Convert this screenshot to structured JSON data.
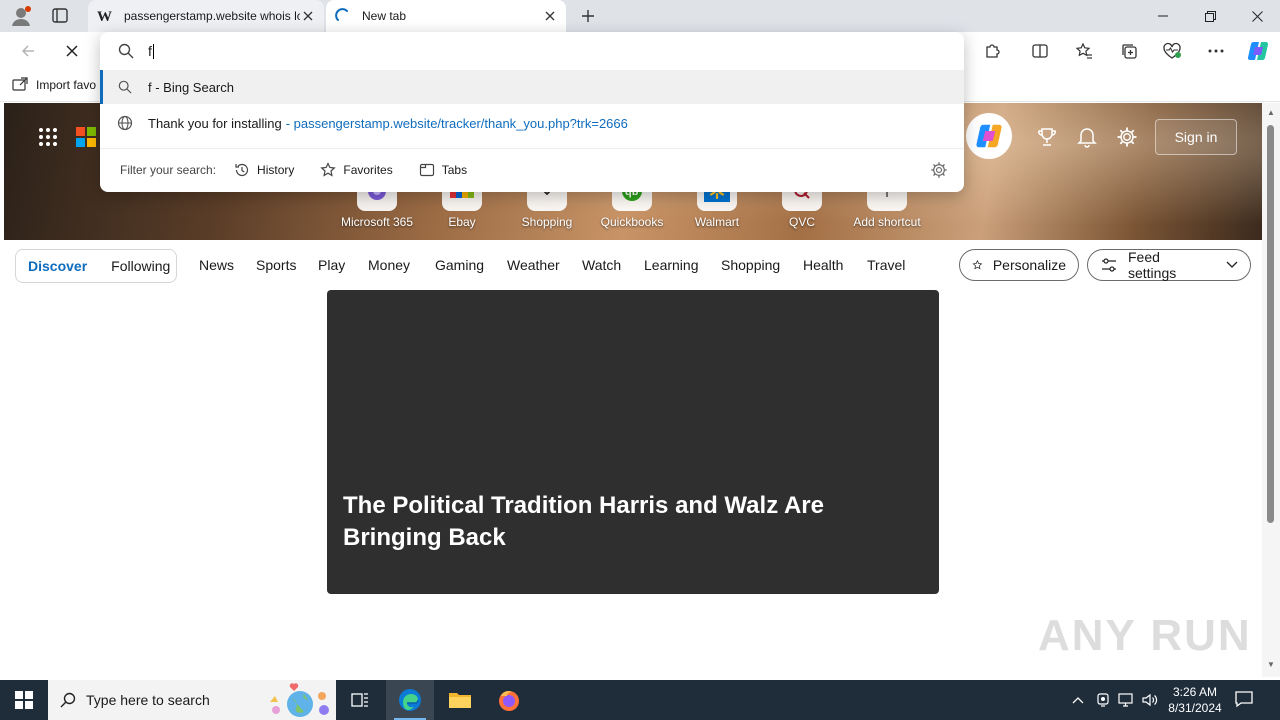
{
  "tabs": [
    {
      "title": "passengerstamp.website whois lc",
      "active": false
    },
    {
      "title": "New tab",
      "active": true
    }
  ],
  "address": {
    "typed": "f"
  },
  "favorites_bar": {
    "import_label": "Import favo"
  },
  "suggestions": [
    {
      "text": "f - Bing Search",
      "type": "search"
    },
    {
      "text": "Thank you for installing",
      "url": "- passengerstamp.website/tracker/thank_you.php?trk=2666",
      "type": "history"
    }
  ],
  "filter": {
    "label": "Filter your search:",
    "chips": [
      "History",
      "Favorites",
      "Tabs"
    ]
  },
  "hero": {
    "sign_in": "Sign in",
    "shortcuts": [
      "Microsoft 365",
      "Ebay",
      "Shopping",
      "Quickbooks",
      "Walmart",
      "QVC",
      "Add shortcut"
    ]
  },
  "feed": {
    "pills": [
      "Discover",
      "Following"
    ],
    "selected_pill": "Discover",
    "nav": [
      "News",
      "Sports",
      "Play",
      "Money",
      "Gaming",
      "Weather",
      "Watch",
      "Learning",
      "Shopping",
      "Health",
      "Travel"
    ],
    "personalize": "Personalize",
    "feed_settings": "Feed settings",
    "feature_title": "The Political Tradition Harris and Walz Are Bringing Back"
  },
  "watermark": "ANY RUN",
  "taskbar": {
    "search_placeholder": "Type here to search",
    "time": "3:26 AM",
    "date": "8/31/2024"
  },
  "colors": {
    "accent": "#0f6cbd",
    "taskbar": "#1f2d3b",
    "tabstrip": "#dfe3e8",
    "card": "#2f2f2f"
  }
}
